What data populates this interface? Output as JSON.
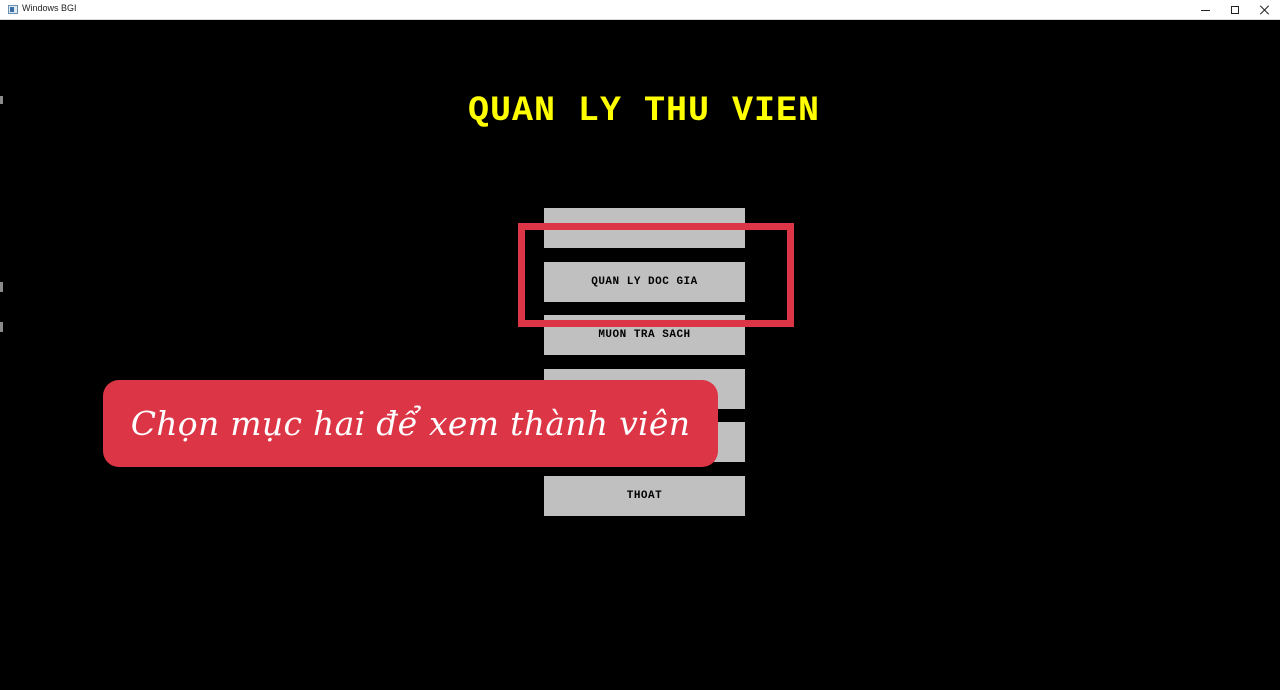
{
  "window": {
    "title": "Windows BGI"
  },
  "app": {
    "title": "QUAN LY THU VIEN"
  },
  "menu": {
    "items": [
      {
        "label": ""
      },
      {
        "label": "QUAN LY DOC GIA"
      },
      {
        "label": "MUON TRA SACH"
      },
      {
        "label": ""
      },
      {
        "label": ""
      },
      {
        "label": "THOAT"
      }
    ]
  },
  "overlay": {
    "caption": "Chọn mục hai để xem thành viên",
    "accent_color": "#dc3545"
  },
  "colors": {
    "background": "#000000",
    "title": "#ffff00",
    "button": "#c0c0c0"
  }
}
